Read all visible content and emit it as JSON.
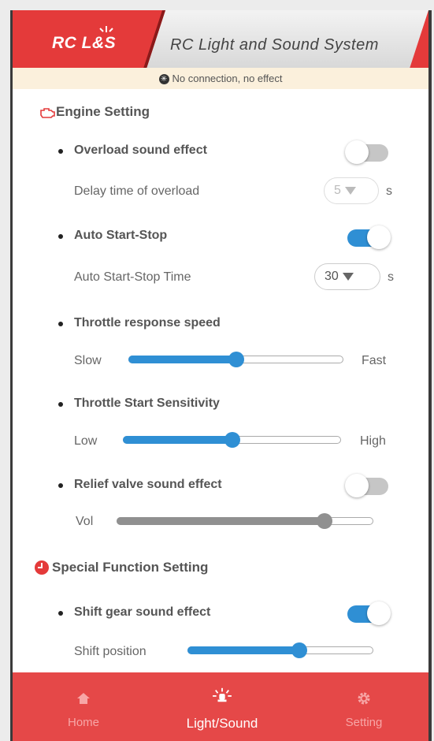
{
  "header": {
    "logo_text": "RC L&S",
    "app_title": "RC Light and Sound System"
  },
  "notice": {
    "text": "No connection, no effect",
    "icon": "bluetooth-icon"
  },
  "engine": {
    "section_title": "Engine Setting",
    "section_icon": "engine-icon",
    "overload": {
      "label": "Overload sound effect",
      "enabled": false
    },
    "overload_delay": {
      "label": "Delay time of overload",
      "value": "5",
      "unit": "s"
    },
    "auto_start_stop": {
      "label": "Auto Start-Stop",
      "enabled": true
    },
    "auto_start_stop_time": {
      "label": "Auto Start-Stop Time",
      "value": "30",
      "unit": "s"
    },
    "throttle_response": {
      "label": "Throttle response speed",
      "min_label": "Slow",
      "max_label": "Fast",
      "level": 0.5
    },
    "throttle_sensitivity": {
      "label": "Throttle Start Sensitivity",
      "min_label": "Low",
      "max_label": "High",
      "level": 0.5
    },
    "relief_valve": {
      "label": "Relief valve sound effect",
      "enabled": false,
      "vol_label": "Vol",
      "level": 0.81
    }
  },
  "special": {
    "section_title": "Special Function Setting",
    "section_icon": "special-function-icon",
    "shift_gear": {
      "label": "Shift gear sound effect",
      "enabled": true
    },
    "shift_position": {
      "label": "Shift position",
      "level": 0.6
    }
  },
  "nav": {
    "items": [
      {
        "label": "Home",
        "icon": "home-icon",
        "active": false
      },
      {
        "label": "Light/Sound",
        "icon": "light-sound-icon",
        "active": true
      },
      {
        "label": "Setting",
        "icon": "gear-icon",
        "active": false
      }
    ]
  },
  "colors": {
    "header_red": "#e43a3a",
    "nav_red": "#e54848",
    "accent_blue": "#2f8fd4",
    "notice_bg": "#fbf0dc"
  }
}
